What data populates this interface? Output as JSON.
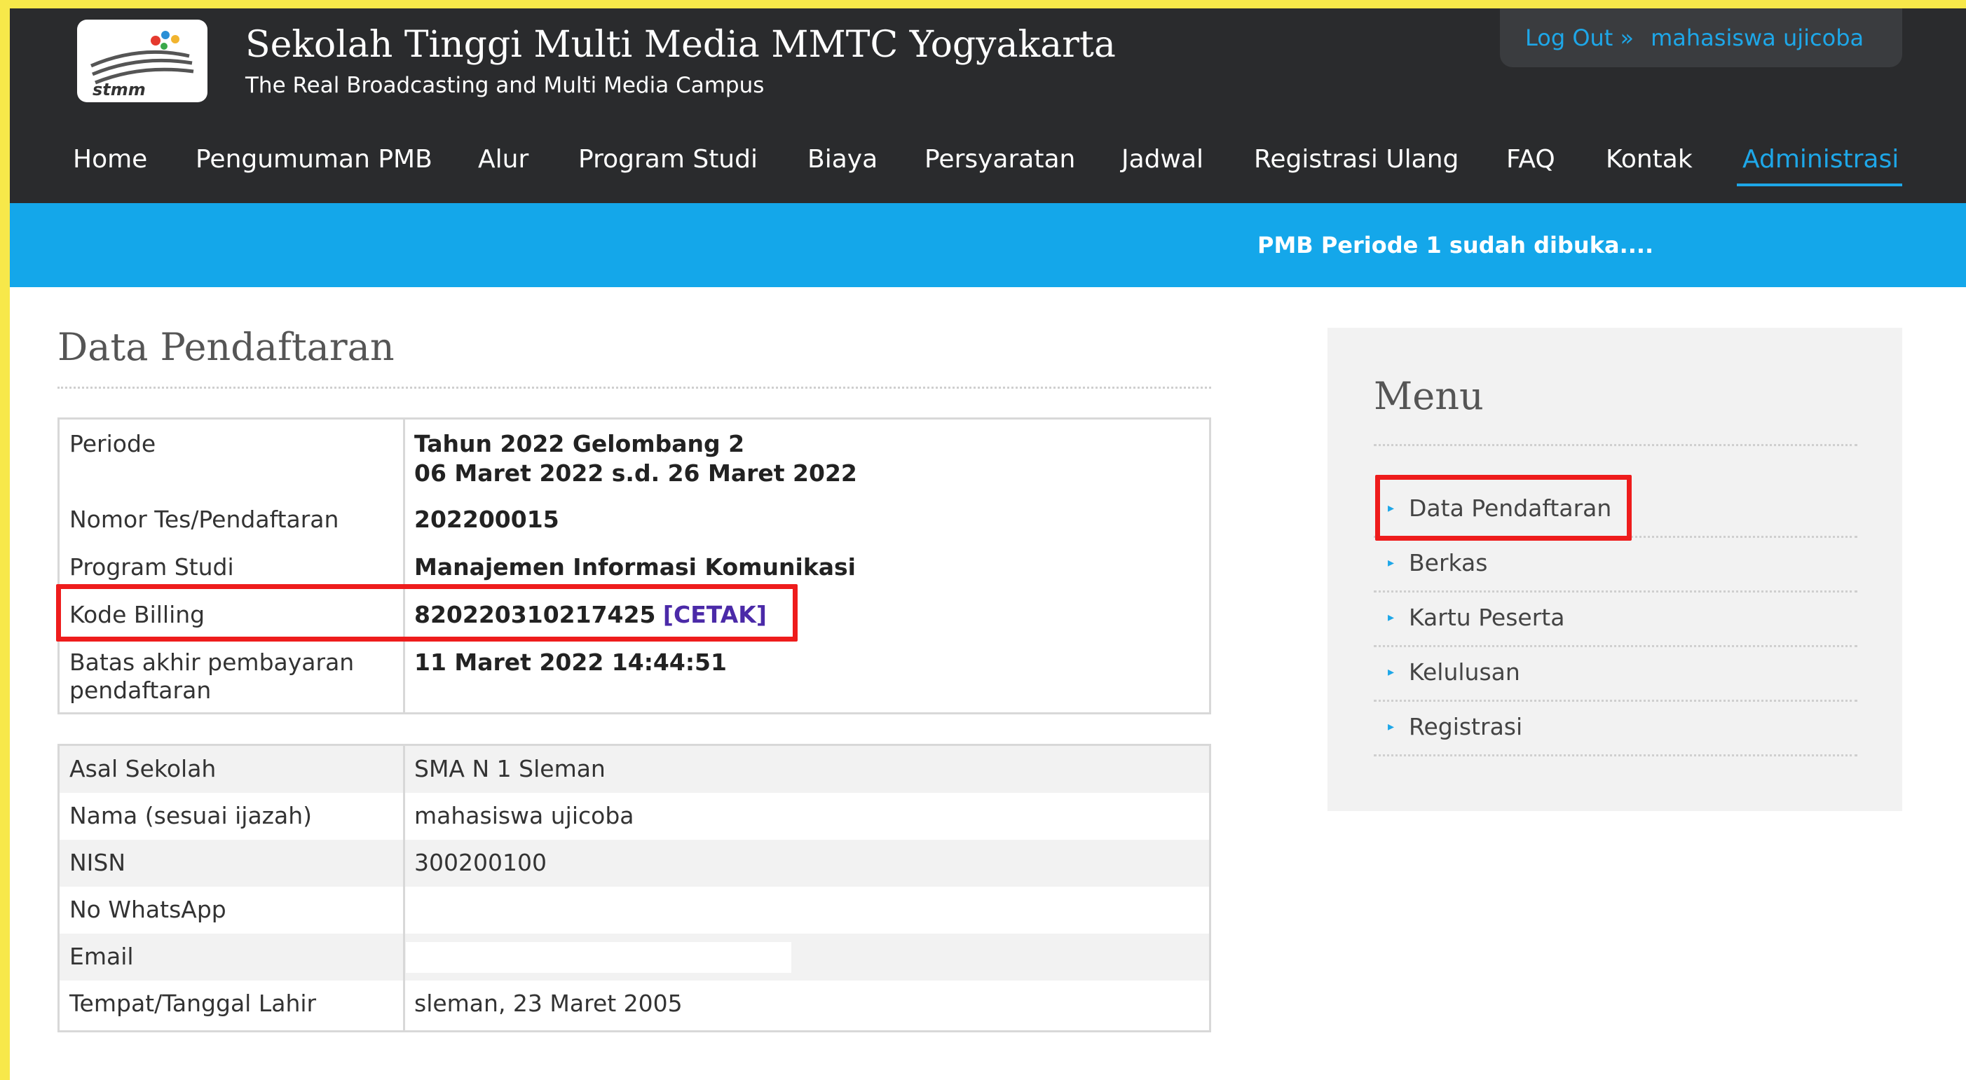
{
  "header": {
    "site_title": "Sekolah Tinggi Multi Media MMTC Yogyakarta",
    "tagline": "The Real Broadcasting and Multi Media Campus",
    "logo_text": "stmm",
    "logout_label": "Log Out »",
    "user_name": "mahasiswa ujicoba",
    "logout_link_color": "#1ea7e8"
  },
  "nav": {
    "items": [
      {
        "label": "Home"
      },
      {
        "label": "Pengumuman PMB"
      },
      {
        "label": "Alur"
      },
      {
        "label": "Program Studi"
      },
      {
        "label": "Biaya"
      },
      {
        "label": "Persyaratan"
      },
      {
        "label": "Jadwal"
      },
      {
        "label": "Registrasi Ulang"
      },
      {
        "label": "FAQ"
      },
      {
        "label": "Kontak"
      },
      {
        "label": "Administrasi",
        "active": true
      }
    ],
    "active_color": "#1ea7e8"
  },
  "announcement": {
    "text": "PMB Periode 1 sudah dibuka....",
    "bar_color": "#14a7ea"
  },
  "main": {
    "title": "Data Pendaftaran",
    "registration": {
      "periode_label": "Periode",
      "periode_line1": "Tahun 2022 Gelombang 2",
      "periode_line2": "06 Maret 2022 s.d. 26 Maret 2022",
      "nomor_label": "Nomor Tes/Pendaftaran",
      "nomor_value": "202200015",
      "prodi_label": "Program Studi",
      "prodi_value": "Manajemen Informasi Komunikasi",
      "billing_label": "Kode Billing",
      "billing_value": "820220310217425",
      "cetak_label": "[CETAK]",
      "batas_label_line1": "Batas akhir pembayaran",
      "batas_label_line2": "pendaftaran",
      "batas_value": "11 Maret 2022 14:44:51"
    },
    "profile": {
      "rows": [
        {
          "label": "Asal Sekolah",
          "value": "SMA N 1 Sleman"
        },
        {
          "label": "Nama (sesuai ijazah)",
          "value": "mahasiswa ujicoba"
        },
        {
          "label": "NISN",
          "value": "300200100"
        },
        {
          "label": "No WhatsApp",
          "value": ""
        },
        {
          "label": "Email",
          "value": ""
        },
        {
          "label": "Tempat/Tanggal Lahir",
          "value": "sleman, 23 Maret 2005"
        }
      ]
    }
  },
  "sidebar": {
    "title": "Menu",
    "items": [
      {
        "label": "Data Pendaftaran"
      },
      {
        "label": "Berkas"
      },
      {
        "label": "Kartu Peserta"
      },
      {
        "label": "Kelulusan"
      },
      {
        "label": "Registrasi"
      }
    ]
  },
  "highlight_color": "#ee1c1c"
}
